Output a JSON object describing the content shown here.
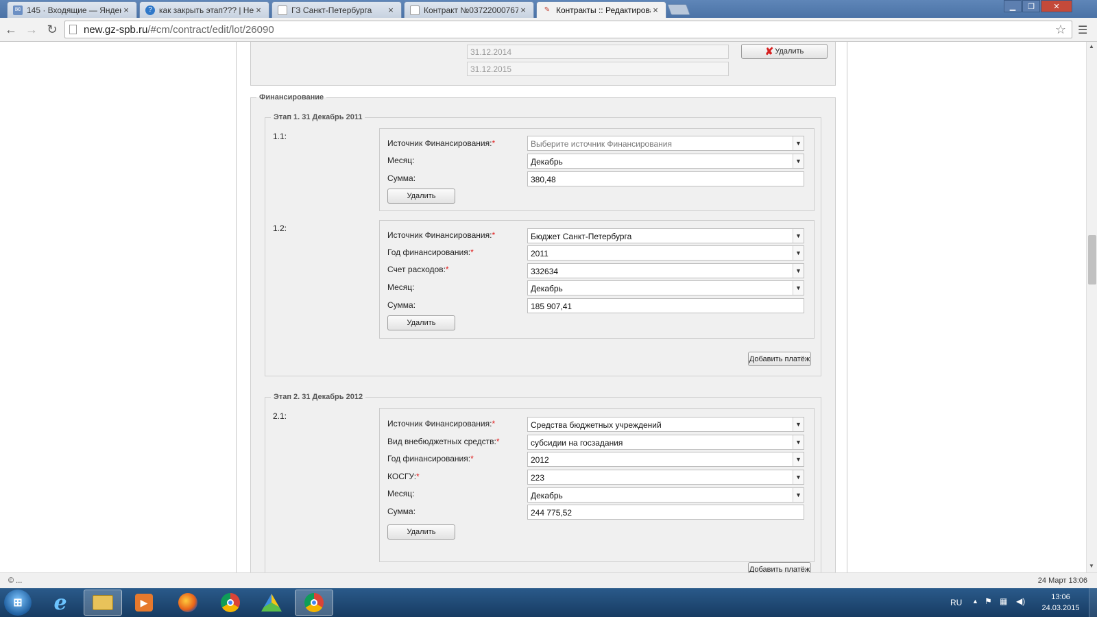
{
  "browser": {
    "tabs": [
      {
        "title": "145 · Входящие — Яндек",
        "icon": "mail-icon",
        "color": "#6b8fc4"
      },
      {
        "title": "как закрыть этап??? | Неі",
        "icon": "help-icon",
        "color": "#2f78c9"
      },
      {
        "title": "ГЗ Санкт-Петербурга",
        "icon": "page-icon",
        "color": "#ffffff"
      },
      {
        "title": "Контракт №03722000767",
        "icon": "page-icon",
        "color": "#ffffff"
      },
      {
        "title": "Контракты :: Редактирова",
        "icon": "tools-icon",
        "color": "#c0392b"
      }
    ],
    "url_host": "new.gz-spb.ru",
    "url_path": "/#cm/contract/edit/lot/26090"
  },
  "top_section": {
    "date1": "31.12.2014",
    "date2": "31.12.2015",
    "delete_label": "Удалить"
  },
  "financing": {
    "legend": "Финансирование",
    "stage1": {
      "legend": "Этап 1. 31 Декабрь 2011",
      "item1": {
        "number": "1.1:",
        "source_label": "Источник Финансирования:",
        "source_value": "Выберите источник Финансирования",
        "month_label": "Месяц:",
        "month_value": "Декабрь",
        "sum_label": "Сумма:",
        "sum_value": "380,48",
        "delete_label": "Удалить"
      },
      "item2": {
        "number": "1.2:",
        "source_label": "Источник Финансирования:",
        "source_value": "Бюджет Санкт-Петербурга",
        "year_label": "Год финансирования:",
        "year_value": "2011",
        "account_label": "Счет расходов:",
        "account_value": "332634",
        "month_label": "Месяц:",
        "month_value": "Декабрь",
        "sum_label": "Сумма:",
        "sum_value": "185 907,41",
        "delete_label": "Удалить"
      },
      "add_payment_label": "Добавить платёж"
    },
    "stage2": {
      "legend": "Этап 2. 31 Декабрь 2012",
      "item1": {
        "number": "2.1:",
        "source_label": "Источник Финансирования:",
        "source_value": "Средства бюджетных учреждений",
        "offbudget_label": "Вид внебюджетных средств:",
        "offbudget_value": "субсидии на госзадания",
        "year_label": "Год финансирования:",
        "year_value": "2012",
        "kosgu_label": "КОСГУ:",
        "kosgu_value": "223",
        "month_label": "Месяц:",
        "month_value": "Декабрь",
        "sum_label": "Сумма:",
        "sum_value": "244 775,52",
        "delete_label": "Удалить"
      },
      "add_payment_label": "Добавить платёж"
    },
    "required_mark": "*"
  },
  "statusbar": {
    "left": "© ...",
    "right": "24 Март 13:06"
  },
  "taskbar": {
    "apps": [
      "ie-icon",
      "explorer-icon",
      "media-player-icon",
      "firefox-icon",
      "chrome-icon",
      "yandex-disk-icon",
      "chrome-icon"
    ],
    "lang": "RU",
    "time": "13:06",
    "date": "24.03.2015"
  }
}
